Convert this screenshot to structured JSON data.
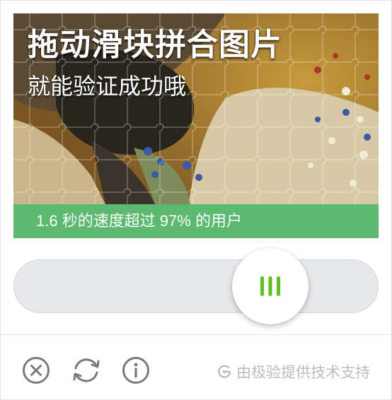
{
  "captcha": {
    "headline": "拖动滑块拼合图片",
    "subline": "就能验证成功哦",
    "result_text": "1.6 秒的速度超过 97% 的用户",
    "slider_progress": 0.66
  },
  "footer": {
    "close_icon": "close-circle-icon",
    "refresh_icon": "refresh-icon",
    "info_icon": "info-icon",
    "brand_text": "由极验提供技术支持"
  },
  "colors": {
    "success_green": "#5bba6f",
    "knob_grip_green": "#5cc21f",
    "icon_gray": "#7a7a7a",
    "brand_gray": "#bdbdbd"
  }
}
